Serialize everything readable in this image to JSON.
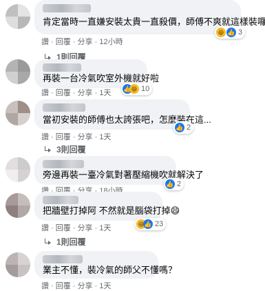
{
  "comments": [
    {
      "text": "肯定當時一直嫌安裝太貴一直殺價，師傅不爽就這樣裝囉",
      "like": "讚",
      "reply": "回覆",
      "share": "分享",
      "time": "12小時",
      "reaction_icons": [
        "haha-icon",
        "like-icon"
      ],
      "reaction_count": "3",
      "replies": "1則回覆"
    },
    {
      "text": "再裝一台冷氣吹室外機就好啦",
      "like": "讚",
      "reply": "回覆",
      "share": "分享",
      "time": "1天",
      "reaction_icons": [
        "like-icon",
        "haha-icon"
      ],
      "reaction_count": "10",
      "replies": ""
    },
    {
      "text": "當初安裝的師傅也太誇張吧，怎麼裝在這...",
      "like": "讚",
      "reply": "回覆",
      "share": "分享",
      "time": "1天",
      "reaction_icons": [
        "like-icon"
      ],
      "reaction_count": "2",
      "replies": "3則回覆"
    },
    {
      "text": "旁邊再裝一臺冷氣對著壓縮機吹就解決了",
      "like": "讚",
      "reply": "回覆",
      "share": "分享",
      "time": "18小時",
      "reaction_icons": [
        "like-icon"
      ],
      "reaction_count": "2",
      "replies": ""
    },
    {
      "text": "把牆壁打掉阿 不然就是腦袋打掉😄",
      "like": "讚",
      "reply": "回覆",
      "share": "分享",
      "time": "1天",
      "reaction_icons": [
        "haha-icon",
        "like-icon"
      ],
      "reaction_count": "23",
      "replies": "1則回覆"
    },
    {
      "text": "業主不懂，裝冷氣的師父不懂嗎？",
      "like": "讚",
      "reply": "回覆",
      "share": "分享",
      "time": "1天",
      "reaction_icons": [
        "like-icon"
      ],
      "reaction_count": "2",
      "replies": ""
    }
  ],
  "colors": {
    "bubble": "#f0f2f5",
    "meta_text": "#65676b",
    "like_blue": "#1877f2",
    "haha_yellow": "#f7b928"
  }
}
